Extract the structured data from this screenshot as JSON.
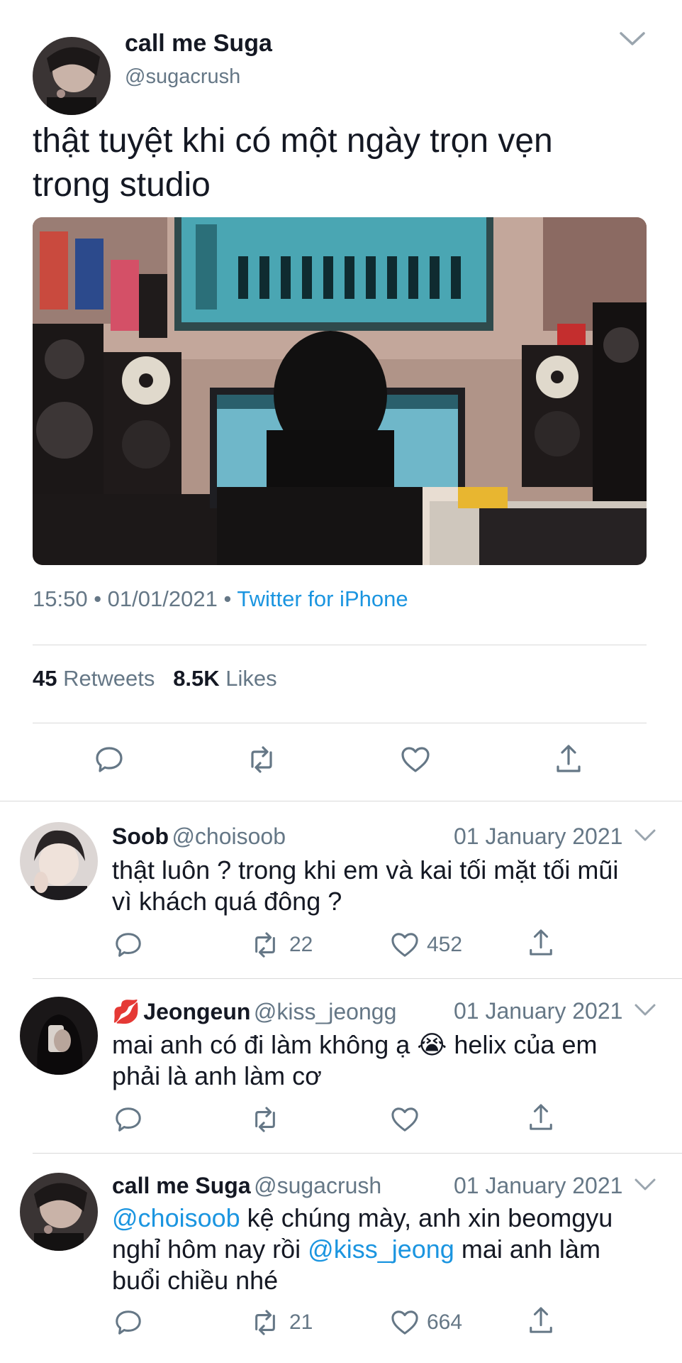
{
  "tweet": {
    "display_name": "call me Suga",
    "handle": "@sugacrush",
    "text": "thật tuyệt khi có một ngày trọn vẹn trong studio",
    "time": "15:50",
    "date": "01/01/2021",
    "source": "Twitter for iPhone",
    "retweets_count": "45",
    "retweets_label": "Retweets",
    "likes_count": "8.5K",
    "likes_label": "Likes"
  },
  "replies": [
    {
      "display_name": "Soob",
      "handle": "@choisoob",
      "date": "01 January 2021",
      "text_1": "thật luôn ? trong khi em và kai tối mặt tối mũi",
      "text_2": "vì khách quá đông ?",
      "retweets": "22",
      "likes": "452"
    },
    {
      "emoji": "💋",
      "display_name": "Jeongeun",
      "handle": "@kiss_jeongg",
      "date": "01 January 2021",
      "text_1": "mai anh có đi làm không ạ",
      "emoji_inline": "😭",
      "text_1b": "helix của em",
      "text_2": "phải là anh làm cơ"
    },
    {
      "display_name": "call me Suga",
      "handle": "@sugacrush",
      "date": "01 January 2021",
      "mention_1": "@choisoob",
      "text_1": "kệ chúng mày, anh xin beomgyu",
      "text_2a": "nghỉ hôm nay rồi",
      "mention_2": "@kiss_jeong",
      "text_2b": "mai anh làm",
      "text_3": "buổi chiều nhé",
      "retweets": "21",
      "likes": "664"
    }
  ],
  "colors": {
    "link": "#1b95e0",
    "secondary": "#657786",
    "text": "#141823",
    "divider": "#d9d9d9"
  }
}
